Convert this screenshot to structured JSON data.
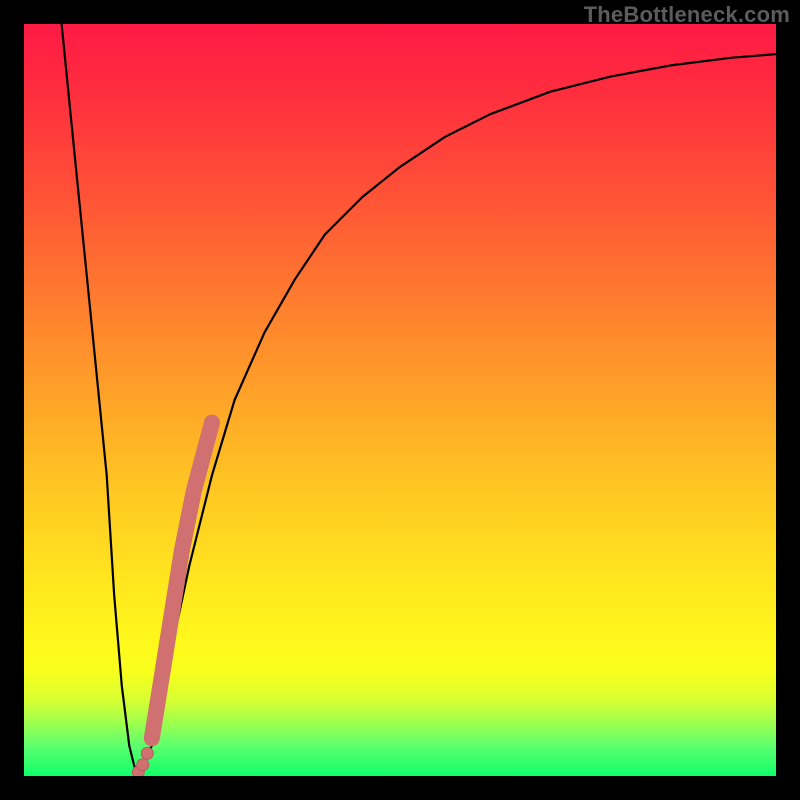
{
  "watermark": {
    "text": "TheBottleneck.com"
  },
  "colors": {
    "curve_stroke": "#000000",
    "marker_fill": "#d07070",
    "marker_stroke": "#b85a5a"
  },
  "chart_data": {
    "type": "line",
    "title": "",
    "xlabel": "",
    "ylabel": "",
    "xlim": [
      0,
      100
    ],
    "ylim": [
      0,
      100
    ],
    "series": [
      {
        "name": "bottleneck-curve",
        "x": [
          5,
          7,
          9,
          11,
          12,
          13,
          14,
          15,
          17,
          19,
          22,
          25,
          28,
          32,
          36,
          40,
          45,
          50,
          56,
          62,
          70,
          78,
          86,
          94,
          100
        ],
        "y": [
          100,
          80,
          60,
          40,
          24,
          12,
          4,
          0,
          4,
          14,
          28,
          40,
          50,
          59,
          66,
          72,
          77,
          81,
          85,
          88,
          91,
          93,
          94.5,
          95.5,
          96
        ]
      }
    ],
    "markers": {
      "name": "highlight-segment",
      "x": [
        17.0,
        17.8,
        18.6,
        19.4,
        20.2,
        21.0,
        21.8,
        22.6,
        23.4,
        24.2,
        25.0
      ],
      "y": [
        5,
        10,
        15,
        20,
        25,
        30,
        34,
        38,
        41,
        44,
        47
      ]
    },
    "extra_markers": {
      "name": "near-minimum",
      "x": [
        15.2,
        15.8,
        16.4
      ],
      "y": [
        0.5,
        1.5,
        3
      ]
    }
  }
}
